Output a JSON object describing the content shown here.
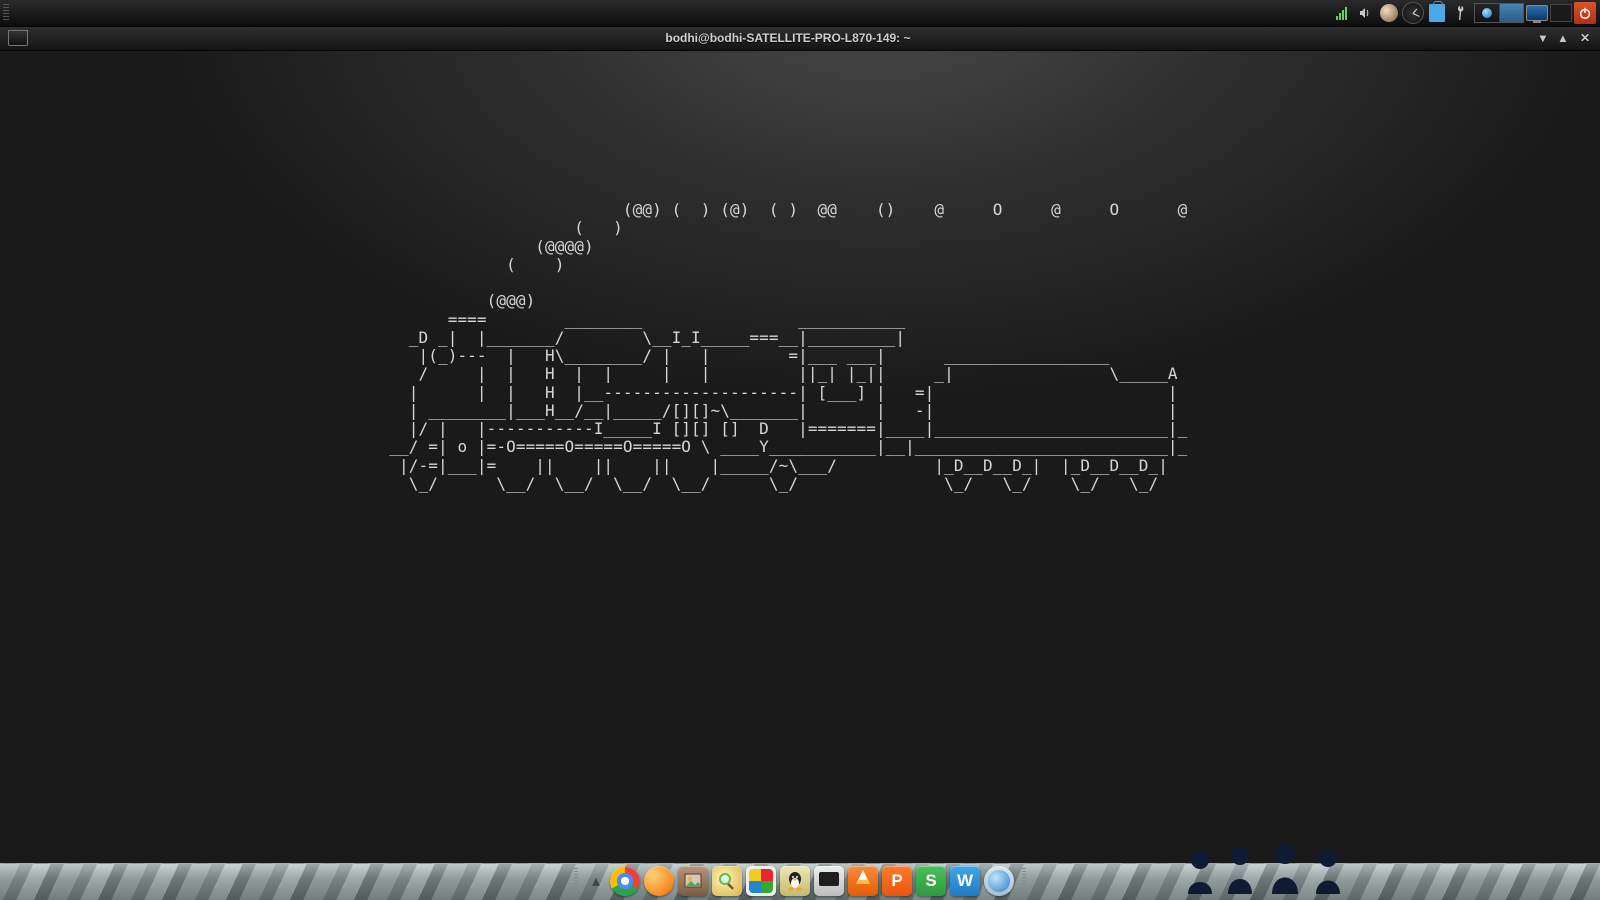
{
  "window": {
    "title": "bodhi@bodhi-SATELLITE-PRO-L870-149: ~"
  },
  "terminal": {
    "sl_art": "                                                                (@@) (  ) (@)  ( )  @@    ()    @     O     @     O      @\n                                                           (   )\n                                                       (@@@@)\n                                                    (    )\n\n                                                  (@@@)\n                                              ====        ________                ___________\n                                          _D _|  |_______/        \\__I_I_____===__|_________|\n                                           |(_)---  |   H\\________/ |   |        =|___ ___|      _________________\n                                           /     |  |   H  |  |     |   |         ||_| |_||     _|                \\_____A\n                                          |      |  |   H  |__--------------------| [___] |   =|                        |\n                                          | ________|___H__/__|_____/[][]~\\_______|       |   -|                        |\n                                          |/ |   |-----------I_____I [][] []  D   |=======|____|________________________|_\n                                        __/ =| o |=-O=====O=====O=====O \\ ____Y___________|__|__________________________|_\n                                         |/-=|___|=    ||    ||    ||    |_____/~\\___/          |_D__D__D_|  |_D__D__D_|\n                                          \\_/      \\__/  \\__/  \\__/  \\__/      \\_/               \\_/   \\_/    \\_/   \\_/"
  },
  "window_controls": {
    "minimize": "▾",
    "maximize": "▴",
    "close": "✕"
  },
  "tray": {
    "network_icon": "network-bars-icon",
    "volume_icon": "speaker-icon",
    "user_icon": "user-avatar-icon",
    "clock_icon": "analog-clock-icon",
    "clipboard_icon": "clipboard-icon",
    "tool_icon": "wrench-icon",
    "monitor_icon": "display-icon",
    "power_icon": "power-icon"
  },
  "dock": {
    "items": [
      {
        "name": "chrome",
        "label": ""
      },
      {
        "name": "clementine",
        "label": ""
      },
      {
        "name": "image-viewer",
        "label": ""
      },
      {
        "name": "search",
        "label": ""
      },
      {
        "name": "puzzle",
        "label": ""
      },
      {
        "name": "supertux",
        "label": ""
      },
      {
        "name": "system-monitor",
        "label": ""
      },
      {
        "name": "vlc",
        "label": ""
      },
      {
        "name": "wps-presentation",
        "label": "P"
      },
      {
        "name": "wps-spreadsheet",
        "label": "S"
      },
      {
        "name": "wps-writer",
        "label": "W"
      },
      {
        "name": "browser-globe",
        "label": ""
      }
    ],
    "arrow": "▴"
  }
}
